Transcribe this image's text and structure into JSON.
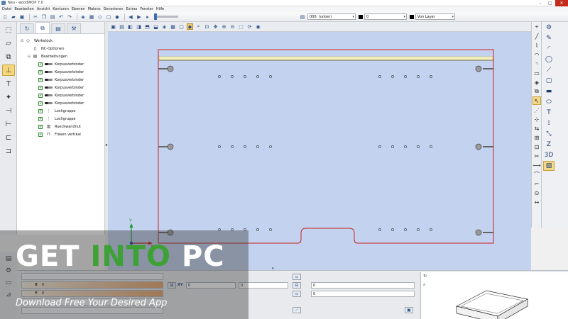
{
  "window": {
    "title": "Neu - woodWOP 7.0",
    "controls": {
      "minimize": "–",
      "maximize": "□",
      "close": "✕"
    }
  },
  "menu": {
    "items": [
      "Datei",
      "Bearbeiten",
      "Ansicht",
      "Konturen",
      "Ebenen",
      "Makros",
      "Generieren",
      "Extras",
      "Fenster",
      "Hilfe"
    ]
  },
  "toolbar": {
    "layer_combo": "000: (unten)",
    "color_value": "0",
    "layer_mode": "Von Layer"
  },
  "tree": {
    "items": [
      {
        "label": "Werkstück",
        "level": 0,
        "icon": "workpiece-icon"
      },
      {
        "label": "NC-Optionen",
        "level": 1,
        "icon": "nc-options-icon"
      },
      {
        "label": "Bearbeitungen",
        "level": 1,
        "icon": "operations-icon"
      },
      {
        "label": "Korpusverbinder",
        "level": 2,
        "icon": "connector-icon",
        "checked": true
      },
      {
        "label": "Korpusverbinder",
        "level": 2,
        "icon": "connector-icon",
        "checked": true
      },
      {
        "label": "Korpusverbinder",
        "level": 2,
        "icon": "connector-icon",
        "checked": true
      },
      {
        "label": "Korpusverbinder",
        "level": 2,
        "icon": "connector-icon",
        "checked": true
      },
      {
        "label": "Korpusverbinder",
        "level": 2,
        "icon": "connector-icon",
        "checked": true
      },
      {
        "label": "Korpusverbinder",
        "level": 2,
        "icon": "connector-icon",
        "checked": true
      },
      {
        "label": "Lochgruppe",
        "level": 2,
        "icon": "hole-group-icon",
        "checked": true
      },
      {
        "label": "Lochgruppe",
        "level": 2,
        "icon": "hole-group-icon",
        "checked": true
      },
      {
        "label": "Rueckwandnut",
        "level": 2,
        "icon": "groove-icon",
        "checked": true
      },
      {
        "label": "Fräsen vertikal",
        "level": 2,
        "icon": "milling-icon",
        "checked": true
      }
    ]
  },
  "canvas": {
    "axis_labels": {
      "x": "X",
      "y": "Y"
    }
  },
  "properties": {
    "x_label": "X",
    "x_value": "0",
    "y_label": "Y",
    "y_value": "0",
    "xy_label": "XY",
    "xy_value_1": "0",
    "xy_value_2": "0",
    "field_right_1": "0",
    "field_right_2": "0"
  },
  "watermark": {
    "title_prefix": "GET ",
    "title_highlight": "INTO",
    "title_suffix": " PC",
    "subtitle": "Download Free Your Desired App"
  }
}
